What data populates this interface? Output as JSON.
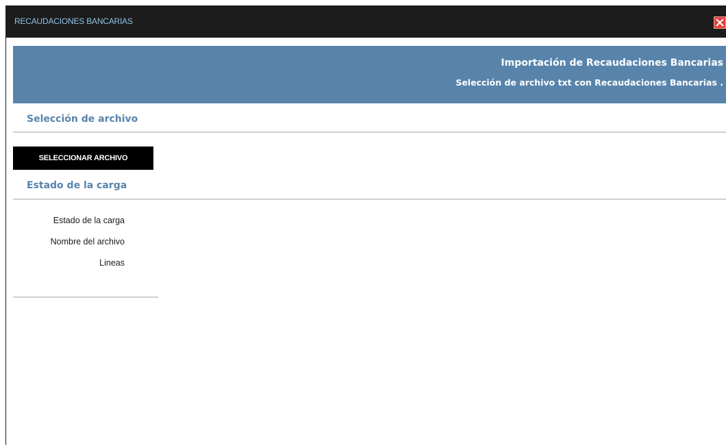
{
  "window": {
    "title": "RECAUDACIONES BANCARIAS",
    "close_icon": "close-icon"
  },
  "header": {
    "title": "Importación de Recaudaciones Bancarias",
    "subtitle": "Selección de archivo txt con Recaudaciones Bancarias ."
  },
  "file_section": {
    "title": "Selección de archivo",
    "select_button_label": "SELECCIONAR ARCHIVO"
  },
  "status_section": {
    "title": "Estado de la carga",
    "fields": [
      {
        "label": "Estado de la carga"
      },
      {
        "label": "Nombre del archivo"
      },
      {
        "label": "Lineas"
      }
    ]
  },
  "colors": {
    "titlebar_bg": "#1c1c1c",
    "title_text": "#8fc3e6",
    "header_bg": "#5884ab",
    "section_title": "#5884ab",
    "close_bg": "#e4423a"
  }
}
